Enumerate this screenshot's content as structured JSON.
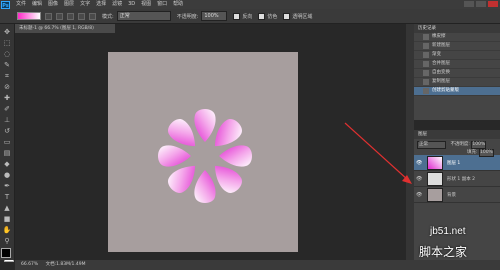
{
  "menubar": {
    "logo": "Ps",
    "items": [
      "文件",
      "编辑",
      "图像",
      "图层",
      "文字",
      "选择",
      "滤镜",
      "3D",
      "视图",
      "窗口",
      "帮助"
    ]
  },
  "optionsbar": {
    "mode_label": "模式:",
    "mode_value": "正常",
    "opacity_label": "不透明度:",
    "opacity_value": "100%",
    "reverse_label": "反向",
    "dither_label": "仿色",
    "transparency_label": "透明区域"
  },
  "document": {
    "tab_title": "未标题-1 @ 66.7% (图层 1, RGB/8)",
    "zoom": "66.67%",
    "doc_info": "文档:1.83M/1.49M"
  },
  "history": {
    "title": "历史记录",
    "items": [
      "橡皮擦",
      "新建图层",
      "渐变",
      "合并图层",
      "自由变换",
      "复制图层",
      "创建剪贴蒙版"
    ],
    "active_index": 6
  },
  "layers": {
    "title": "图层",
    "blend_mode": "正常",
    "opacity_label": "不透明度:",
    "opacity_value": "100%",
    "fill_label": "填充:",
    "fill_value": "100%",
    "rows": [
      {
        "name": "图层 1",
        "active": true
      },
      {
        "name": "形状 1 副本 2",
        "active": false
      },
      {
        "name": "背景",
        "active": false
      }
    ]
  },
  "colors": {
    "petal_dark": "#e02ad0",
    "petal_light": "#ffffff",
    "artboard": "#a79e9e",
    "arrow": "#e03030"
  },
  "watermark": {
    "line1": "jb51.net",
    "line2": "脚本之家"
  }
}
